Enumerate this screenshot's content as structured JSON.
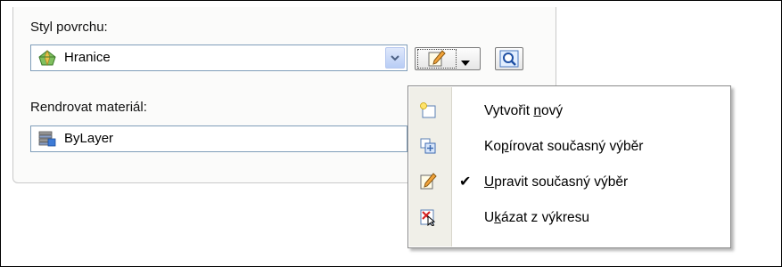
{
  "surface_style": {
    "label": "Styl povrchu:",
    "value": "Hranice",
    "icon": "surface-style-icon"
  },
  "render_material": {
    "label": "Rendrovat materiál:",
    "value": "ByLayer",
    "icon": "layer-stack-icon"
  },
  "toolbar": {
    "edit_icon": "pencil-edit-icon",
    "zoom_icon": "magnifier-icon"
  },
  "menu": {
    "items": [
      {
        "pre": "Vytvořit ",
        "ul": "n",
        "post": "ový",
        "icon": "new-style-icon",
        "checked": false
      },
      {
        "pre": "Ko",
        "ul": "p",
        "post": "írovat současný výběr",
        "icon": "copy-style-icon",
        "checked": false
      },
      {
        "pre": "",
        "ul": "U",
        "post": "pravit současný výběr",
        "icon": "edit-style-icon",
        "checked": true
      },
      {
        "pre": "U",
        "ul": "k",
        "post": "ázat z výkresu",
        "icon": "pick-from-drawing-icon",
        "checked": false
      }
    ],
    "check_mark": "✔"
  }
}
